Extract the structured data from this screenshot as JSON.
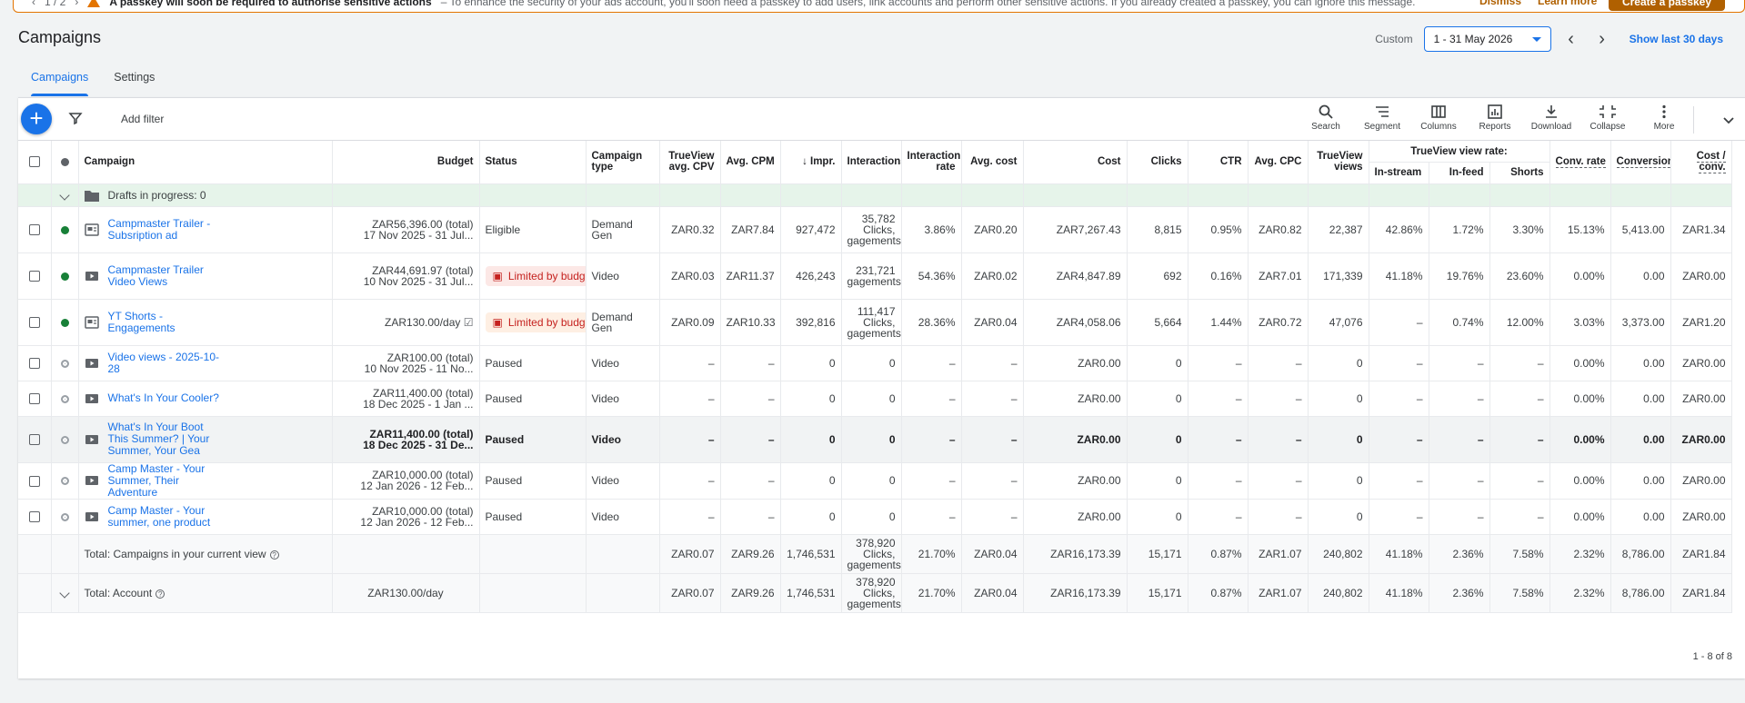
{
  "banner": {
    "page_indicator": "1 / 2",
    "title": "A passkey will soon be required to authorise sensitive actions",
    "message": "– To enhance the security of your ads account, you'll soon need a passkey to add users, link accounts and perform other sensitive actions. If you already created a passkey, you can ignore this message.",
    "dismiss": "Dismiss",
    "learn_more": "Learn more",
    "create": "Create a passkey"
  },
  "header": {
    "title": "Campaigns",
    "custom_label": "Custom",
    "date_range": "1 - 31 May 2026",
    "show_last": "Show last 30 days"
  },
  "tabs": [
    {
      "label": "Campaigns"
    },
    {
      "label": "Settings"
    }
  ],
  "toolbar": {
    "add_filter": "Add filter",
    "tools": [
      {
        "label": "Search",
        "icon": "search-icon"
      },
      {
        "label": "Segment",
        "icon": "segment-icon"
      },
      {
        "label": "Columns",
        "icon": "columns-icon"
      },
      {
        "label": "Reports",
        "icon": "reports-icon"
      },
      {
        "label": "Download",
        "icon": "download-icon"
      },
      {
        "label": "Collapse",
        "icon": "collapse-icon"
      },
      {
        "label": "More",
        "icon": "more-icon"
      }
    ]
  },
  "columns": {
    "campaign": "Campaign",
    "budget": "Budget",
    "status": "Status",
    "type": "Campaign type",
    "cpv": "TrueView avg. CPV",
    "cpm": "Avg. CPM",
    "impr": "Impr.",
    "interactions": "Interactions",
    "interaction_rate": "Interaction rate",
    "avg_cost": "Avg. cost",
    "cost": "Cost",
    "clicks": "Clicks",
    "ctr": "CTR",
    "cpc": "Avg. CPC",
    "views": "TrueView views",
    "view_rate_group": "TrueView view rate:",
    "instream": "In-stream",
    "infeed": "In-feed",
    "shorts": "Shorts",
    "conv_rate": "Conv. rate",
    "conversions": "Conversions",
    "cost_conv": "Cost / conv."
  },
  "drafts_label": "Drafts in progress: 0",
  "rows": [
    {
      "status_dot": "green",
      "icon": "demand-gen-icon",
      "name": "Campmaster Trailer - Subsription ad",
      "budget_line1": "ZAR56,396.00 (total)",
      "budget_line2": "17 Nov 2025 - 31 Jul...",
      "status": "Eligible",
      "type": "Demand Gen",
      "cpv": "ZAR0.32",
      "cpm": "ZAR7.84",
      "impr": "927,472",
      "int1": "35,782",
      "int2": "Clicks,",
      "int3": "gagements",
      "int_rate": "3.86%",
      "avg_cost": "ZAR0.20",
      "cost": "ZAR7,267.43",
      "clicks": "8,815",
      "ctr": "0.95%",
      "cpc": "ZAR0.82",
      "views": "22,387",
      "instream": "42.86%",
      "infeed": "1.72%",
      "shorts": "3.30%",
      "conv_rate": "15.13%",
      "conversions": "5,413.00",
      "cost_conv": "ZAR1.34"
    },
    {
      "status_dot": "green",
      "icon": "video-icon",
      "name": "Campmaster Trailer Video Views",
      "budget_line1": "ZAR44,691.97 (total)",
      "budget_line2": "10 Nov 2025 - 31 Jul...",
      "status": "Limited by budget",
      "type": "Video",
      "cpv": "ZAR0.03",
      "cpm": "ZAR11.37",
      "impr": "426,243",
      "int1": "231,721",
      "int2": "gagements",
      "int3": "",
      "int_rate": "54.36%",
      "avg_cost": "ZAR0.02",
      "cost": "ZAR4,847.89",
      "clicks": "692",
      "ctr": "0.16%",
      "cpc": "ZAR7.01",
      "views": "171,339",
      "instream": "41.18%",
      "infeed": "19.76%",
      "shorts": "23.60%",
      "conv_rate": "0.00%",
      "conversions": "0.00",
      "cost_conv": "ZAR0.00"
    },
    {
      "status_dot": "green",
      "icon": "demand-gen-icon",
      "name": "YT Shorts - Engagements",
      "budget_line1": "ZAR130.00/day",
      "budget_line2": "",
      "status": "Limited by budget",
      "type": "Demand Gen",
      "cpv": "ZAR0.09",
      "cpm": "ZAR10.33",
      "impr": "392,816",
      "int1": "111,417",
      "int2": "Clicks,",
      "int3": "gagements",
      "int_rate": "28.36%",
      "avg_cost": "ZAR0.04",
      "cost": "ZAR4,058.06",
      "clicks": "5,664",
      "ctr": "1.44%",
      "cpc": "ZAR0.72",
      "views": "47,076",
      "instream": "–",
      "infeed": "0.74%",
      "shorts": "12.00%",
      "conv_rate": "3.03%",
      "conversions": "3,373.00",
      "cost_conv": "ZAR1.20"
    },
    {
      "status_dot": "grey",
      "icon": "video-icon",
      "name": "Video views - 2025-10-28",
      "budget_line1": "ZAR100.00 (total)",
      "budget_line2": "10 Nov 2025 - 11 No...",
      "status": "Paused",
      "type": "Video",
      "cpv": "–",
      "cpm": "–",
      "impr": "0",
      "int1": "0",
      "int2": "",
      "int3": "",
      "int_rate": "–",
      "avg_cost": "–",
      "cost": "ZAR0.00",
      "clicks": "0",
      "ctr": "–",
      "cpc": "–",
      "views": "0",
      "instream": "–",
      "infeed": "–",
      "shorts": "–",
      "conv_rate": "0.00%",
      "conversions": "0.00",
      "cost_conv": "ZAR0.00"
    },
    {
      "status_dot": "grey",
      "icon": "video-icon",
      "name": "What's In Your Cooler?",
      "budget_line1": "ZAR11,400.00 (total)",
      "budget_line2": "18 Dec 2025 - 1 Jan ...",
      "status": "Paused",
      "type": "Video",
      "cpv": "–",
      "cpm": "–",
      "impr": "0",
      "int1": "0",
      "int2": "",
      "int3": "",
      "int_rate": "–",
      "avg_cost": "–",
      "cost": "ZAR0.00",
      "clicks": "0",
      "ctr": "–",
      "cpc": "–",
      "views": "0",
      "instream": "–",
      "infeed": "–",
      "shorts": "–",
      "conv_rate": "0.00%",
      "conversions": "0.00",
      "cost_conv": "ZAR0.00"
    },
    {
      "status_dot": "grey",
      "icon": "video-icon",
      "name": "What's In Your Boot This Summer? | Your Summer, Your Gea",
      "budget_line1": "ZAR11,400.00 (total)",
      "budget_line2": "18 Dec 2025 - 31 De...",
      "status": "Paused",
      "type": "Video",
      "cpv": "–",
      "cpm": "–",
      "impr": "0",
      "int1": "0",
      "int2": "",
      "int3": "",
      "int_rate": "–",
      "avg_cost": "–",
      "cost": "ZAR0.00",
      "clicks": "0",
      "ctr": "–",
      "cpc": "–",
      "views": "0",
      "instream": "–",
      "infeed": "–",
      "shorts": "–",
      "conv_rate": "0.00%",
      "conversions": "0.00",
      "cost_conv": "ZAR0.00"
    },
    {
      "status_dot": "grey",
      "icon": "video-icon",
      "name": "Camp Master - Your Summer, Their Adventure",
      "budget_line1": "ZAR10,000.00 (total)",
      "budget_line2": "12 Jan 2026 - 12 Feb...",
      "status": "Paused",
      "type": "Video",
      "cpv": "–",
      "cpm": "–",
      "impr": "0",
      "int1": "0",
      "int2": "",
      "int3": "",
      "int_rate": "–",
      "avg_cost": "–",
      "cost": "ZAR0.00",
      "clicks": "0",
      "ctr": "–",
      "cpc": "–",
      "views": "0",
      "instream": "–",
      "infeed": "–",
      "shorts": "–",
      "conv_rate": "0.00%",
      "conversions": "0.00",
      "cost_conv": "ZAR0.00"
    },
    {
      "status_dot": "grey",
      "icon": "video-icon",
      "name": "Camp Master - Your summer, one product",
      "budget_line1": "ZAR10,000.00 (total)",
      "budget_line2": "12 Jan 2026 - 12 Feb...",
      "status": "Paused",
      "type": "Video",
      "cpv": "–",
      "cpm": "–",
      "impr": "0",
      "int1": "0",
      "int2": "",
      "int3": "",
      "int_rate": "–",
      "avg_cost": "–",
      "cost": "ZAR0.00",
      "clicks": "0",
      "ctr": "–",
      "cpc": "–",
      "views": "0",
      "instream": "–",
      "infeed": "–",
      "shorts": "–",
      "conv_rate": "0.00%",
      "conversions": "0.00",
      "cost_conv": "ZAR0.00"
    }
  ],
  "totals": [
    {
      "label": "Total: Campaigns in your current view",
      "budget": "",
      "cpv": "ZAR0.07",
      "cpm": "ZAR9.26",
      "impr": "1,746,531",
      "int1": "378,920",
      "int2": "Clicks,",
      "int3": "gagements",
      "int_rate": "21.70%",
      "avg_cost": "ZAR0.04",
      "cost": "ZAR16,173.39",
      "clicks": "15,171",
      "ctr": "0.87%",
      "cpc": "ZAR1.07",
      "views": "240,802",
      "instream": "41.18%",
      "infeed": "2.36%",
      "shorts": "7.58%",
      "conv_rate": "2.32%",
      "conversions": "8,786.00",
      "cost_conv": "ZAR1.84"
    },
    {
      "label": "Total: Account",
      "budget": "ZAR130.00/day",
      "cpv": "ZAR0.07",
      "cpm": "ZAR9.26",
      "impr": "1,746,531",
      "int1": "378,920",
      "int2": "Clicks,",
      "int3": "gagements",
      "int_rate": "21.70%",
      "avg_cost": "ZAR0.04",
      "cost": "ZAR16,173.39",
      "clicks": "15,171",
      "ctr": "0.87%",
      "cpc": "ZAR1.07",
      "views": "240,802",
      "instream": "41.18%",
      "infeed": "2.36%",
      "shorts": "7.58%",
      "conv_rate": "2.32%",
      "conversions": "8,786.00",
      "cost_conv": "ZAR1.84"
    }
  ],
  "pager": "1 - 8 of 8",
  "colors": {
    "accent": "#1a73e8",
    "enabled": "#188038",
    "warning": "#e37400",
    "limited": "#c5221f"
  }
}
